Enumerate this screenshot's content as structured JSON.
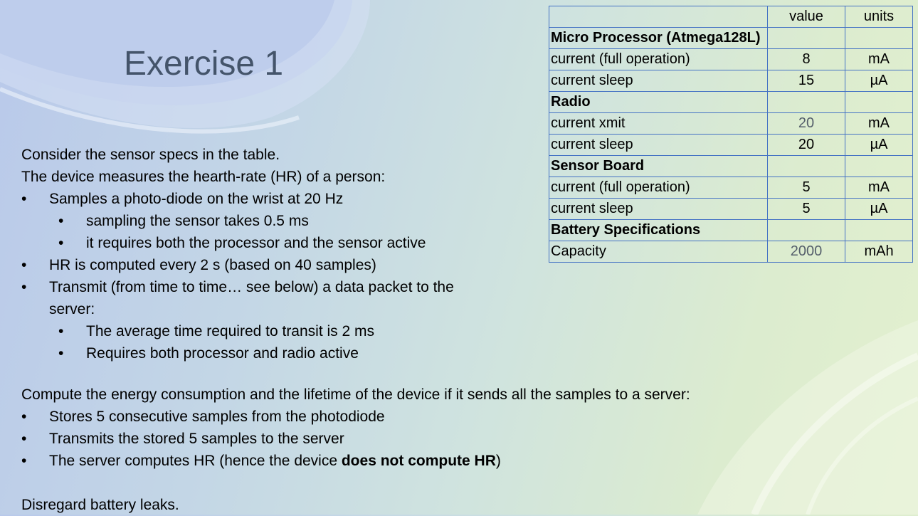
{
  "slide": {
    "title": "Exercise 1",
    "intro": [
      "Consider the sensor specs in the table.",
      "The device measures the hearth-rate (HR) of a person:"
    ],
    "bullets_a": [
      "Samples a photo-diode on the wrist at 20 Hz",
      "sampling the sensor takes 0.5 ms",
      "it requires both the processor and the sensor active",
      "HR is computed every 2 s (based on 40 samples)",
      "Transmit (from time to time… see below) a data packet to the",
      "server:",
      "The average time required to transit is 2 ms",
      "Requires both processor and radio active"
    ],
    "compute_intro": "Compute the energy consumption and the lifetime of the device if it sends all the samples to a server:",
    "bullets_b": [
      "Stores 5 consecutive samples from the photodiode",
      "Transmits the stored 5 samples to the server",
      "The server computes HR (hence the device ",
      "does not compute HR",
      ")"
    ],
    "footer": "Disregard battery leaks."
  },
  "table": {
    "headers": [
      "",
      "value",
      "units"
    ],
    "sections": [
      {
        "name": "Micro Processor (Atmega128L)",
        "rows": [
          {
            "label": "current (full operation)",
            "value": "8",
            "unit": "mA"
          },
          {
            "label": "current sleep",
            "value": "15",
            "unit": "µA"
          }
        ]
      },
      {
        "name": "Radio",
        "rows": [
          {
            "label": "current xmit",
            "value": "20",
            "unit": "mA"
          },
          {
            "label": "current sleep",
            "value": "20",
            "unit": "µA"
          }
        ]
      },
      {
        "name": "Sensor Board",
        "rows": [
          {
            "label": "current (full operation)",
            "value": "5",
            "unit": "mA"
          },
          {
            "label": "current sleep",
            "value": "5",
            "unit": "µA"
          }
        ]
      },
      {
        "name": "Battery Specifications",
        "rows": [
          {
            "label": "Capacity",
            "value": "2000",
            "unit": "mAh"
          }
        ]
      }
    ]
  },
  "colors": {
    "title": "#44546a",
    "table_border": "#4472c4",
    "muted_value": "#555f6b"
  }
}
